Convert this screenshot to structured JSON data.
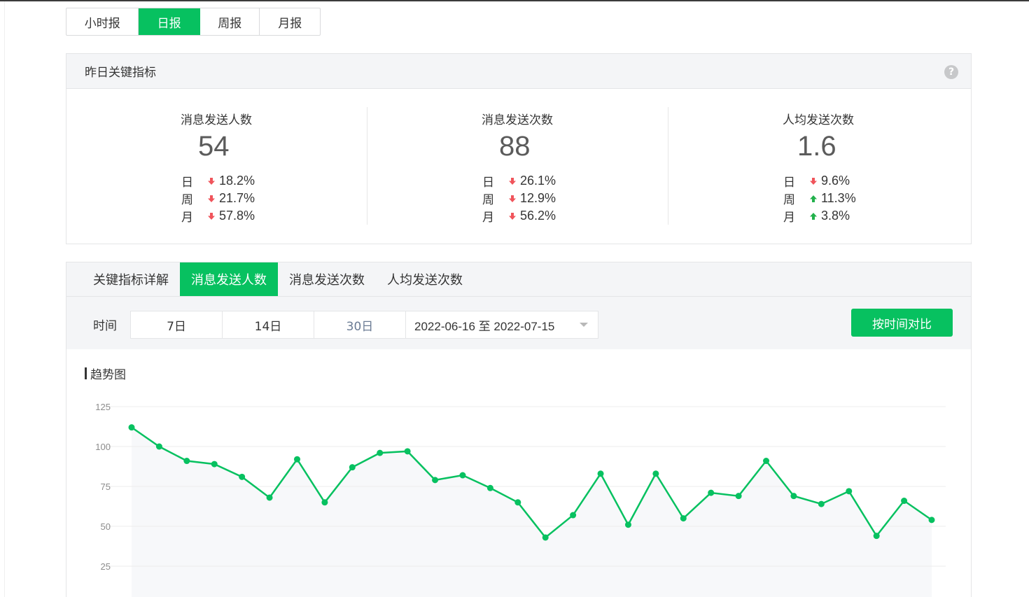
{
  "period_tabs": [
    "小时报",
    "日报",
    "周报",
    "月报"
  ],
  "metrics_panel": {
    "title": "昨日关键指标",
    "help_icon": "?",
    "metrics": [
      {
        "title": "消息发送人数",
        "value": "54",
        "rows": [
          {
            "label": "日",
            "trend": "down",
            "pct": "18.2%"
          },
          {
            "label": "周",
            "trend": "down",
            "pct": "21.7%"
          },
          {
            "label": "月",
            "trend": "down",
            "pct": "57.8%"
          }
        ]
      },
      {
        "title": "消息发送次数",
        "value": "88",
        "rows": [
          {
            "label": "日",
            "trend": "down",
            "pct": "26.1%"
          },
          {
            "label": "周",
            "trend": "down",
            "pct": "12.9%"
          },
          {
            "label": "月",
            "trend": "down",
            "pct": "56.2%"
          }
        ]
      },
      {
        "title": "人均发送次数",
        "value": "1.6",
        "rows": [
          {
            "label": "日",
            "trend": "down",
            "pct": "9.6%"
          },
          {
            "label": "周",
            "trend": "up",
            "pct": "11.3%"
          },
          {
            "label": "月",
            "trend": "up",
            "pct": "3.8%"
          }
        ]
      }
    ]
  },
  "detail_tabs": [
    "关键指标详解",
    "消息发送人数",
    "消息发送次数",
    "人均发送次数"
  ],
  "filter": {
    "label": "时间",
    "ranges": [
      "7日",
      "14日",
      "30日"
    ],
    "date_range": "2022-06-16 至 2022-07-15",
    "compare_button": "按时间对比"
  },
  "chart_title": "趋势图",
  "colors": {
    "accent": "#07c160",
    "down": "#f0545b",
    "up": "#22b14c",
    "panel_bg": "#f4f5f7"
  },
  "chart_data": {
    "type": "line",
    "title": "",
    "ylim": [
      0,
      125
    ],
    "yticks": [
      125,
      100,
      75,
      50,
      25
    ],
    "x": [
      1,
      2,
      3,
      4,
      5,
      6,
      7,
      8,
      9,
      10,
      11,
      12,
      13,
      14,
      15,
      16,
      17,
      18,
      19,
      20,
      21,
      22,
      23,
      24,
      25,
      26,
      27,
      28,
      29,
      30
    ],
    "series": [
      {
        "values": [
          112,
          100,
          91,
          89,
          81,
          68,
          92,
          65,
          87,
          96,
          97,
          79,
          82,
          74,
          65,
          43,
          57,
          83,
          51,
          83,
          55,
          71,
          69,
          91,
          69,
          64,
          72,
          44,
          66,
          54
        ]
      }
    ]
  }
}
